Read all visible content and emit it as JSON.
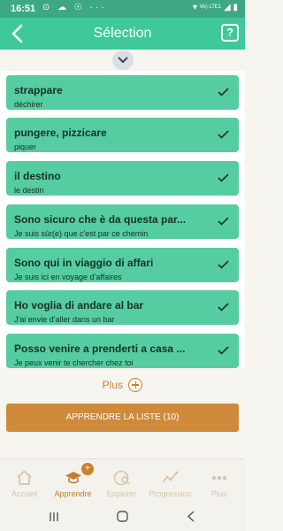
{
  "status": {
    "time": "16:51",
    "left_icons": "⊙ ☁ ☉ ···",
    "network": "Vo) LTE1"
  },
  "header": {
    "title": "Sélection",
    "help": "?"
  },
  "items": [
    {
      "fr": "strappare",
      "tr": "déchirer"
    },
    {
      "fr": "pungere, pizzicare",
      "tr": "piquer"
    },
    {
      "fr": "il destino",
      "tr": "le destin"
    },
    {
      "fr": "Sono sicuro che è da questa par...",
      "tr": "Je suis sûr(e) que c'est par ce chemin"
    },
    {
      "fr": "Sono qui in viaggio di affari",
      "tr": "Je suis ici en voyage d'affaires"
    },
    {
      "fr": "Ho voglia di andare al bar",
      "tr": "J'ai envie d'aller dans un bar"
    },
    {
      "fr": "Posso venire a prenderti a casa ...",
      "tr": "Je peux venir te chercher chez toi"
    }
  ],
  "more_label": "Plus",
  "learn_button": "APPRENDRE LA LISTE (10)",
  "tabs": [
    {
      "label": "Accueil",
      "icon": "home-icon"
    },
    {
      "label": "Apprendre",
      "icon": "graduation-cap-icon",
      "badge": "+"
    },
    {
      "label": "Explorer",
      "icon": "explore-icon"
    },
    {
      "label": "Progression",
      "icon": "progression-icon"
    },
    {
      "label": "Plus",
      "icon": "more-dots-icon"
    }
  ],
  "colors": {
    "header": "#3fc99b",
    "item": "#55cda0",
    "accent": "#cf8a3b",
    "tab_inactive": "#d8c7a5",
    "tab_active": "#c47f2c"
  }
}
